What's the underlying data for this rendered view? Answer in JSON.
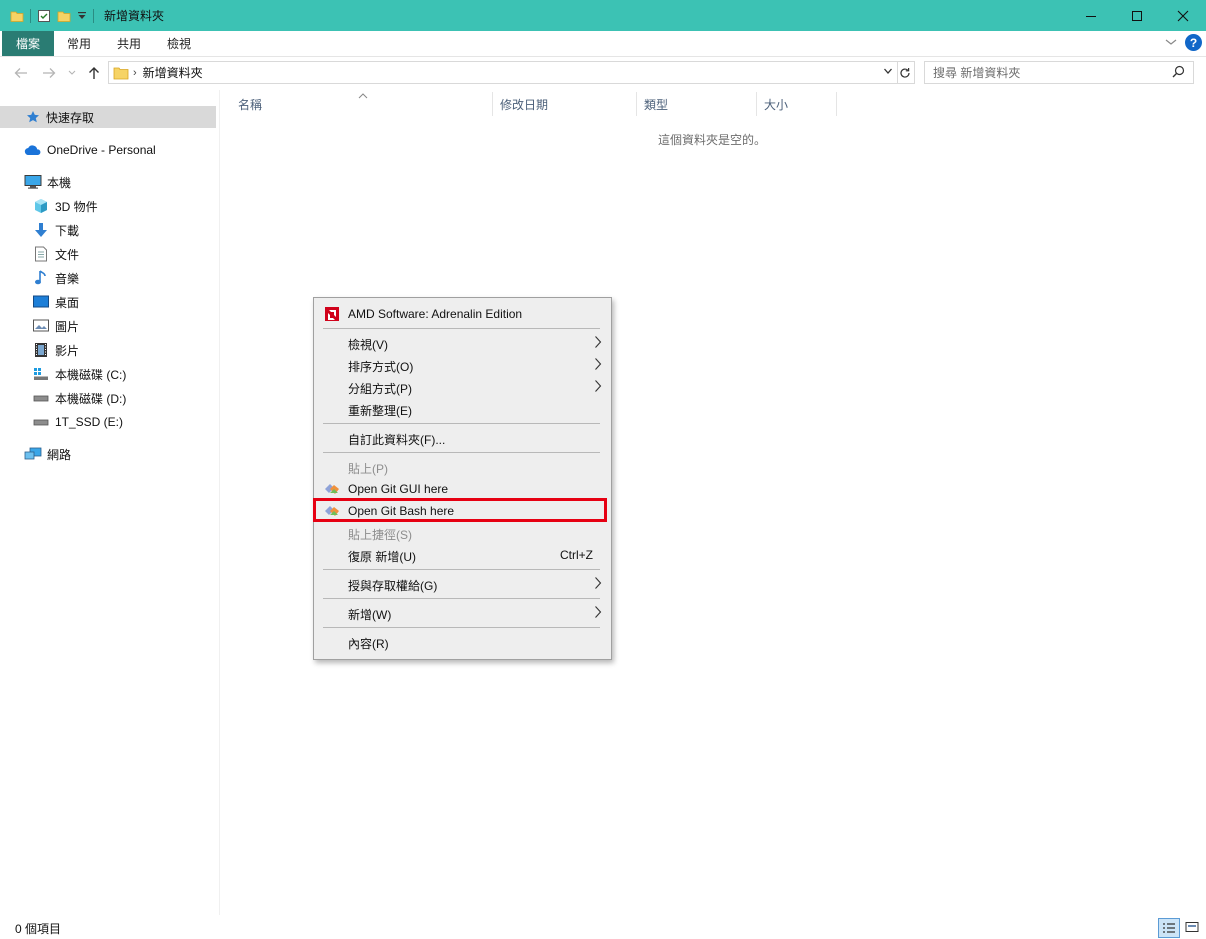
{
  "window": {
    "title": "新增資料夾",
    "colors": {
      "titlebar": "#3cc2b4",
      "file_tab": "#2a7c73",
      "highlight": "#e60012"
    }
  },
  "ribbon": {
    "tabs": [
      "檔案",
      "常用",
      "共用",
      "檢視"
    ]
  },
  "address": {
    "crumb": "新增資料夾",
    "search_placeholder": "搜尋 新增資料夾"
  },
  "nav": {
    "quick_access": "快速存取",
    "onedrive": "OneDrive - Personal",
    "this_pc": "本機",
    "items": [
      {
        "label": "3D 物件",
        "icon": "cube-icon"
      },
      {
        "label": "下載",
        "icon": "download-arrow-icon"
      },
      {
        "label": "文件",
        "icon": "document-icon"
      },
      {
        "label": "音樂",
        "icon": "music-note-icon"
      },
      {
        "label": "桌面",
        "icon": "desktop-icon"
      },
      {
        "label": "圖片",
        "icon": "picture-icon"
      },
      {
        "label": "影片",
        "icon": "film-icon"
      },
      {
        "label": "本機磁碟 (C:)",
        "icon": "windows-drive-icon"
      },
      {
        "label": "本機磁碟 (D:)",
        "icon": "drive-icon"
      },
      {
        "label": "1T_SSD (E:)",
        "icon": "drive-icon"
      }
    ],
    "network": "網路"
  },
  "columns": [
    "名稱",
    "修改日期",
    "類型",
    "大小"
  ],
  "content": {
    "empty_message": "這個資料夾是空的。"
  },
  "status": {
    "item_count": "0 個項目"
  },
  "context_menu": {
    "amd": "AMD Software: Adrenalin Edition",
    "view": "檢視(V)",
    "sort": "排序方式(O)",
    "group": "分組方式(P)",
    "refresh": "重新整理(E)",
    "customize": "自訂此資料夾(F)...",
    "paste": "貼上(P)",
    "git_gui": "Open Git GUI here",
    "git_bash": "Open Git Bash here",
    "paste_shortcut": "貼上捷徑(S)",
    "undo": "復原 新增(U)",
    "undo_shortcut": "Ctrl+Z",
    "give_access": "授與存取權給(G)",
    "new": "新增(W)",
    "properties": "內容(R)"
  }
}
